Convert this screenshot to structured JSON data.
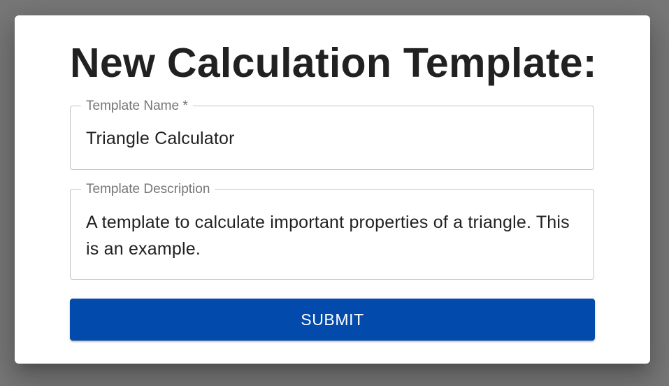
{
  "colors": {
    "backdrop": "#777777",
    "dialog_background": "#ffffff",
    "title_text": "#212121",
    "label_text": "#757575",
    "field_border": "#c4c4c4",
    "submit_background": "#034aad",
    "submit_text": "#ffffff"
  },
  "dialog": {
    "title": "New Calculation Template:"
  },
  "form": {
    "template_name": {
      "label": "Template Name *",
      "value": "Triangle Calculator"
    },
    "template_description": {
      "label": "Template Description",
      "value": "A template to calculate important properties of a triangle. This is an example."
    },
    "submit_label": "SUBMIT"
  }
}
